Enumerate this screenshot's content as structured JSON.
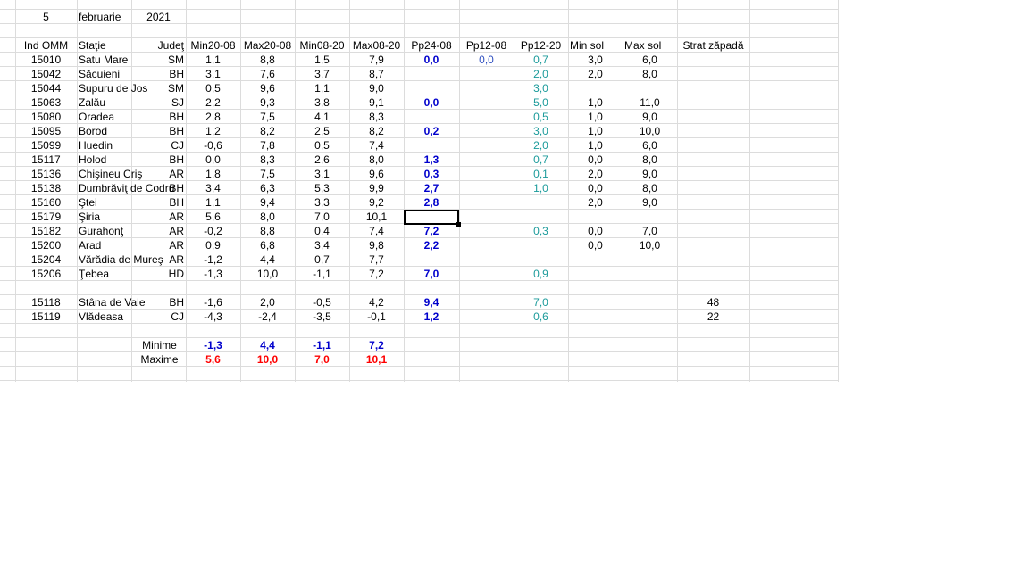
{
  "date": {
    "day": "5",
    "month": "februarie",
    "year": "2021"
  },
  "headers": [
    "Ind OMM",
    "Staţie",
    "Judeţ",
    "Min20-08",
    "Max20-08",
    "Min08-20",
    "Max08-20",
    "Pp24-08",
    "Pp12-08",
    "Pp12-20",
    "Min sol",
    "Max sol",
    "Strat zăpadă"
  ],
  "rows": [
    {
      "id": "15010",
      "station": "Satu Mare",
      "county": "SM",
      "min2008": "1,1",
      "max2008": "8,8",
      "min0820": "1,5",
      "max0820": "7,9",
      "pp2408": "0,0",
      "pp1208": "0,0",
      "pp1220": "0,7",
      "minsol": "3,0",
      "maxsol": "6,0",
      "snow": ""
    },
    {
      "id": "15042",
      "station": "Săcuieni",
      "county": "BH",
      "min2008": "3,1",
      "max2008": "7,6",
      "min0820": "3,7",
      "max0820": "8,7",
      "pp2408": "",
      "pp1208": "",
      "pp1220": "2,0",
      "minsol": "2,0",
      "maxsol": "8,0",
      "snow": ""
    },
    {
      "id": "15044",
      "station": "Supuru de Jos",
      "county": "SM",
      "min2008": "0,5",
      "max2008": "9,6",
      "min0820": "1,1",
      "max0820": "9,0",
      "pp2408": "",
      "pp1208": "",
      "pp1220": "3,0",
      "minsol": "",
      "maxsol": "",
      "snow": ""
    },
    {
      "id": "15063",
      "station": "Zalău",
      "county": "SJ",
      "min2008": "2,2",
      "max2008": "9,3",
      "min0820": "3,8",
      "max0820": "9,1",
      "pp2408": "0,0",
      "pp1208": "",
      "pp1220": "5,0",
      "minsol": "1,0",
      "maxsol": "11,0",
      "snow": ""
    },
    {
      "id": "15080",
      "station": "Oradea",
      "county": "BH",
      "min2008": "2,8",
      "max2008": "7,5",
      "min0820": "4,1",
      "max0820": "8,3",
      "pp2408": "",
      "pp1208": "",
      "pp1220": "0,5",
      "minsol": "1,0",
      "maxsol": "9,0",
      "snow": ""
    },
    {
      "id": "15095",
      "station": "Borod",
      "county": "BH",
      "min2008": "1,2",
      "max2008": "8,2",
      "min0820": "2,5",
      "max0820": "8,2",
      "pp2408": "0,2",
      "pp1208": "",
      "pp1220": "3,0",
      "minsol": "1,0",
      "maxsol": "10,0",
      "snow": ""
    },
    {
      "id": "15099",
      "station": "Huedin",
      "county": "CJ",
      "min2008": "-0,6",
      "max2008": "7,8",
      "min0820": "0,5",
      "max0820": "7,4",
      "pp2408": "",
      "pp1208": "",
      "pp1220": "2,0",
      "minsol": "1,0",
      "maxsol": "6,0",
      "snow": ""
    },
    {
      "id": "15117",
      "station": "Holod",
      "county": "BH",
      "min2008": "0,0",
      "max2008": "8,3",
      "min0820": "2,6",
      "max0820": "8,0",
      "pp2408": "1,3",
      "pp1208": "",
      "pp1220": "0,7",
      "minsol": "0,0",
      "maxsol": "8,0",
      "snow": ""
    },
    {
      "id": "15136",
      "station": "Chişineu   Criş",
      "county": "AR",
      "min2008": "1,8",
      "max2008": "7,5",
      "min0820": "3,1",
      "max0820": "9,6",
      "pp2408": "0,3",
      "pp1208": "",
      "pp1220": "0,1",
      "minsol": "2,0",
      "maxsol": "9,0",
      "snow": ""
    },
    {
      "id": "15138",
      "station": "Dumbrăviţ  de Codru",
      "county": "BH",
      "min2008": "3,4",
      "max2008": "6,3",
      "min0820": "5,3",
      "max0820": "9,9",
      "pp2408": "2,7",
      "pp1208": "",
      "pp1220": "1,0",
      "minsol": "0,0",
      "maxsol": "8,0",
      "snow": ""
    },
    {
      "id": "15160",
      "station": "Ştei",
      "county": "BH",
      "min2008": "1,1",
      "max2008": "9,4",
      "min0820": "3,3",
      "max0820": "9,2",
      "pp2408": "2,8",
      "pp1208": "",
      "pp1220": "",
      "minsol": "2,0",
      "maxsol": "9,0",
      "snow": ""
    },
    {
      "id": "15179",
      "station": "Şiria",
      "county": "AR",
      "min2008": "5,6",
      "max2008": "8,0",
      "min0820": "7,0",
      "max0820": "10,1",
      "pp2408": "",
      "pp1208": "",
      "pp1220": "",
      "minsol": "",
      "maxsol": "",
      "snow": ""
    },
    {
      "id": "15182",
      "station": "Gurahonţ",
      "county": "AR",
      "min2008": "-0,2",
      "max2008": "8,8",
      "min0820": "0,4",
      "max0820": "7,4",
      "pp2408": "7,2",
      "pp1208": "",
      "pp1220": "0,3",
      "minsol": "0,0",
      "maxsol": "7,0",
      "snow": ""
    },
    {
      "id": "15200",
      "station": "Arad",
      "county": "AR",
      "min2008": "0,9",
      "max2008": "6,8",
      "min0820": "3,4",
      "max0820": "9,8",
      "pp2408": "2,2",
      "pp1208": "",
      "pp1220": "",
      "minsol": "0,0",
      "maxsol": "10,0",
      "snow": ""
    },
    {
      "id": "15204",
      "station": "Vărădia de Mureş",
      "county": "AR",
      "min2008": "-1,2",
      "max2008": "4,4",
      "min0820": "0,7",
      "max0820": "7,7",
      "pp2408": "",
      "pp1208": "",
      "pp1220": "",
      "minsol": "",
      "maxsol": "",
      "snow": ""
    },
    {
      "id": "15206",
      "station": "Ţebea",
      "county": "HD",
      "min2008": "-1,3",
      "max2008": "10,0",
      "min0820": "-1,1",
      "max0820": "7,2",
      "pp2408": "7,0",
      "pp1208": "",
      "pp1220": "0,9",
      "minsol": "",
      "maxsol": "",
      "snow": ""
    },
    null,
    {
      "id": "15118",
      "station": "Stâna de Vale",
      "county": "BH",
      "min2008": "-1,6",
      "max2008": "2,0",
      "min0820": "-0,5",
      "max0820": "4,2",
      "pp2408": "9,4",
      "pp1208": "",
      "pp1220": "7,0",
      "minsol": "",
      "maxsol": "",
      "snow": "48"
    },
    {
      "id": "15119",
      "station": "Vlădeasa",
      "county": "CJ",
      "min2008": "-4,3",
      "max2008": "-2,4",
      "min0820": "-3,5",
      "max0820": "-0,1",
      "pp2408": "1,2",
      "pp1208": "",
      "pp1220": "0,6",
      "minsol": "",
      "maxsol": "",
      "snow": "22"
    }
  ],
  "summary": {
    "min_label": "Minime",
    "max_label": "Maxime",
    "min": [
      "-1,3",
      "4,4",
      "-1,1",
      "7,2"
    ],
    "max": [
      "5,6",
      "10,0",
      "7,0",
      "10,1"
    ]
  },
  "colors": {
    "precip": "#0000cc",
    "pp1220": "#1a9a9a",
    "pp1208": "#3050c0",
    "maxima": "#ff0000",
    "gridline": "#dcdcdc"
  }
}
